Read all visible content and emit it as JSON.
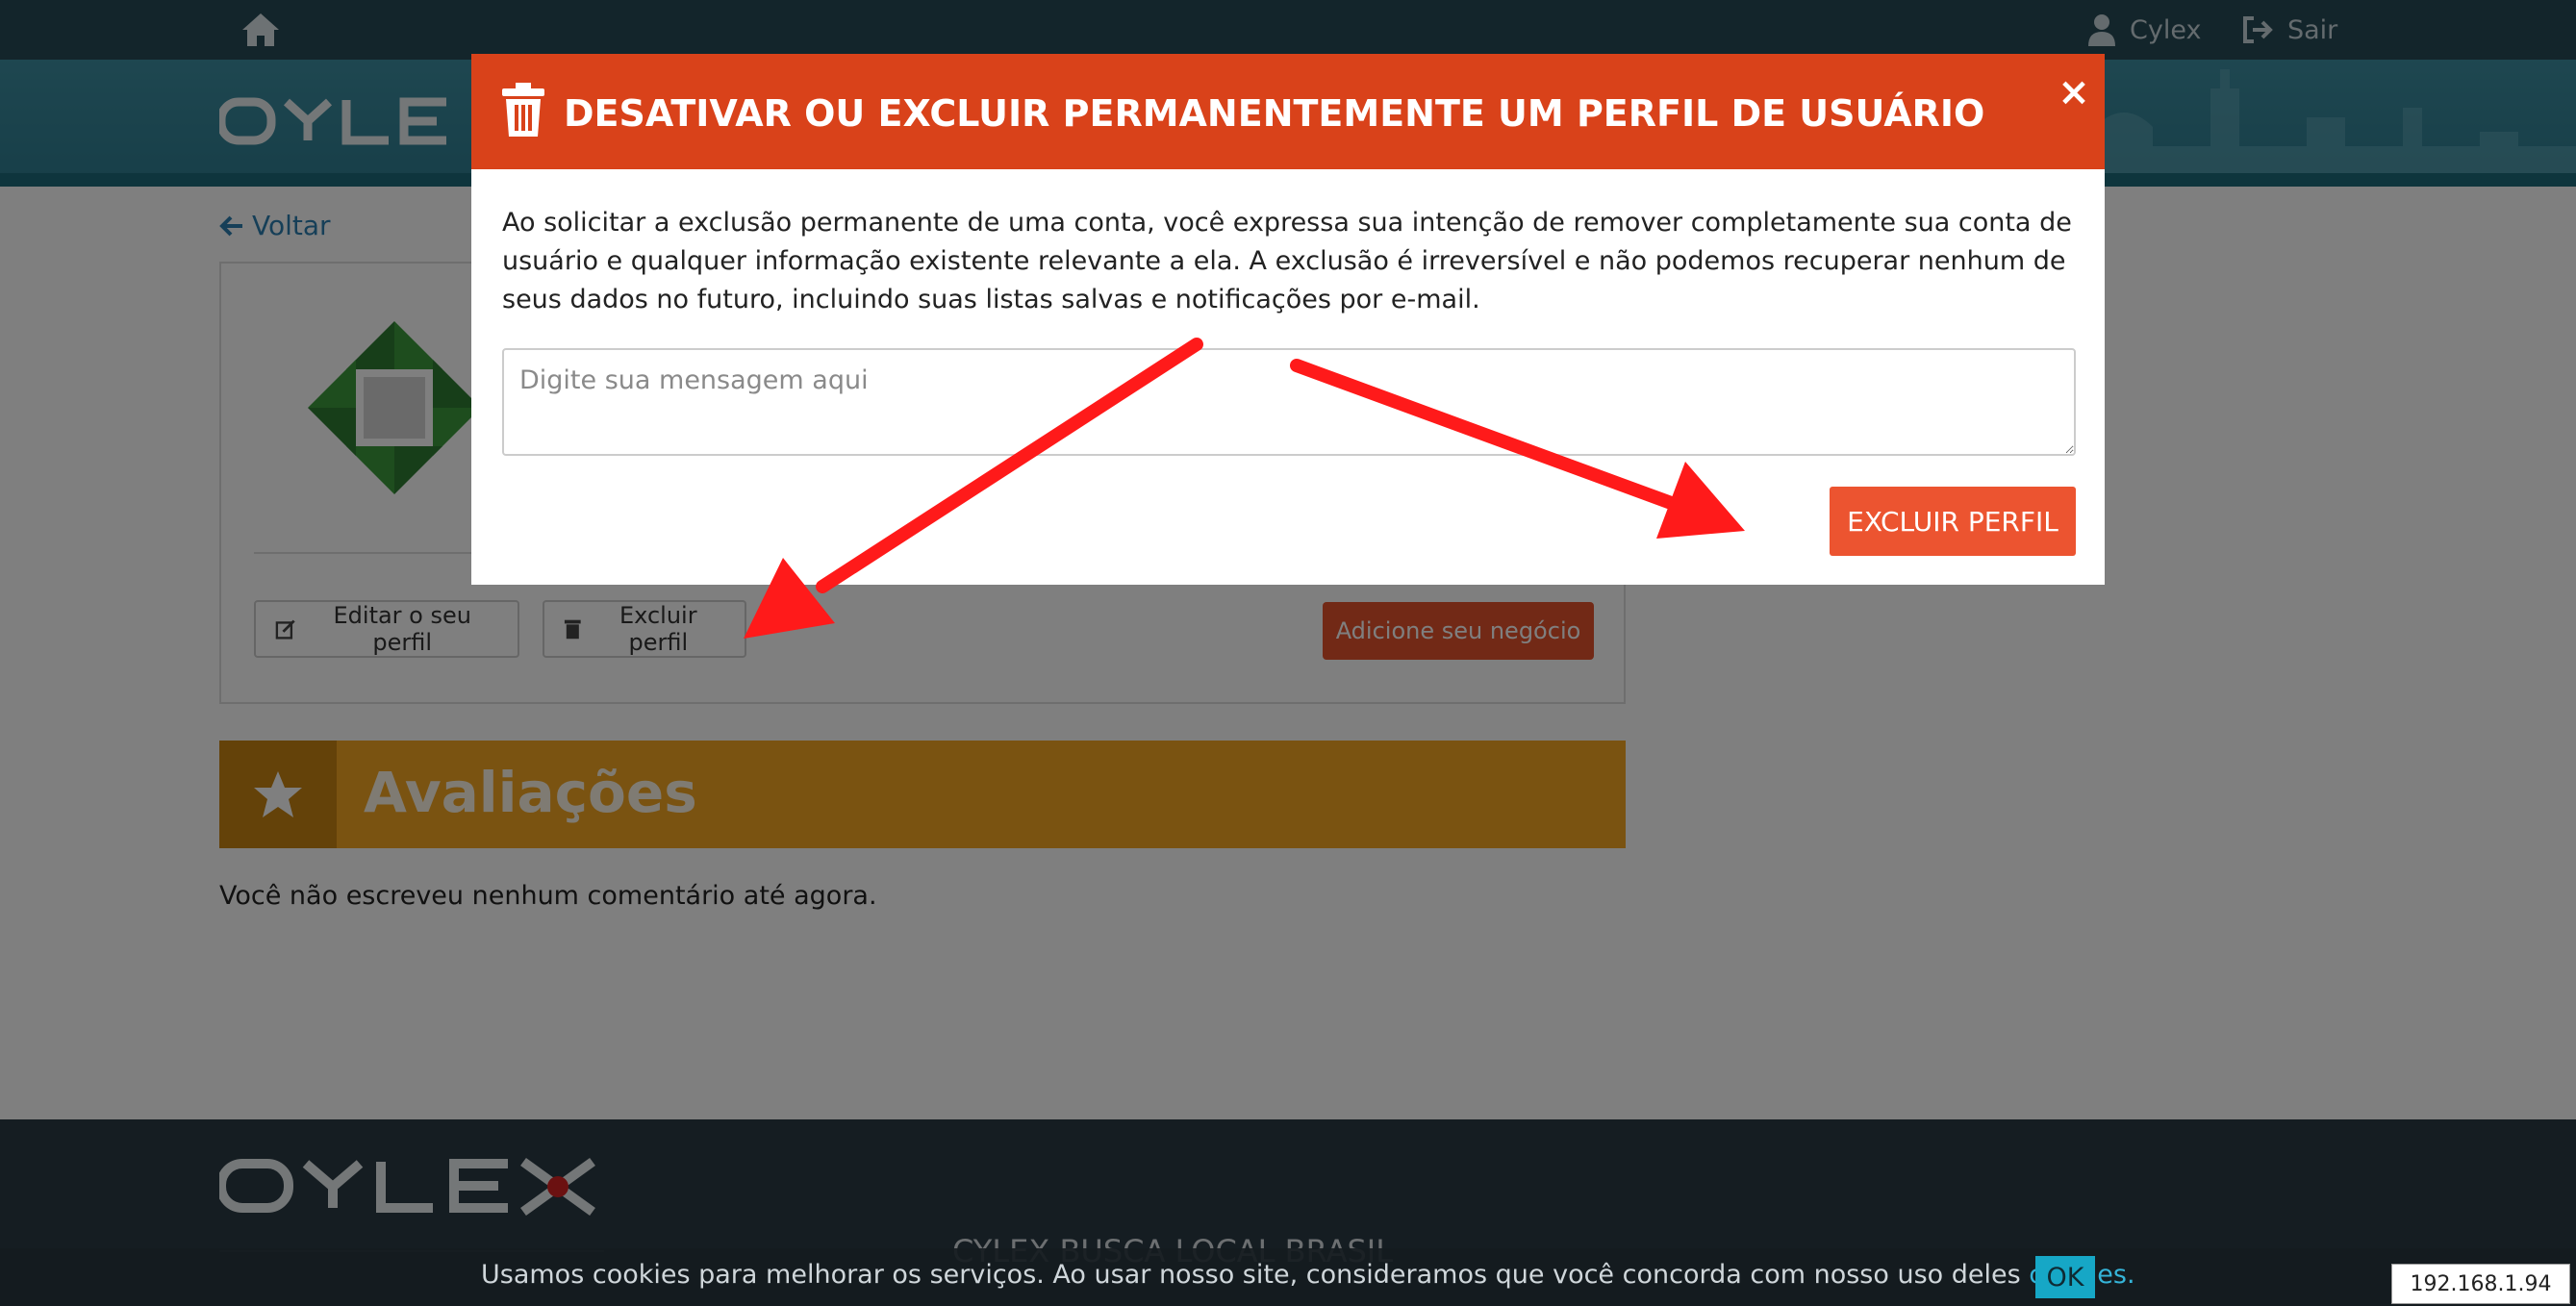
{
  "topbar": {
    "user_label": "Cylex",
    "logout_label": "Sair"
  },
  "page": {
    "back_label": "Voltar",
    "edit_profile_label": "Editar o seu perfil",
    "delete_profile_label": "Excluir perfil",
    "add_business_label": "Adicione seu negócio",
    "reviews_title": "Avaliações",
    "no_reviews_text": "Você não escreveu nenhum comentário até agora."
  },
  "footer": {
    "title": "CYLEX BUSCA LOCAL BRASIL"
  },
  "cookie": {
    "text": "Usamos cookies para melhorar os serviços. Ao usar nosso site, consideramos que você concorda com nosso uso deles",
    "link": "cookies.",
    "ok_label": "OK"
  },
  "ip_badge": "192.168.1.94",
  "modal": {
    "title": "DESATIVAR OU EXCLUIR PERMANENTEMENTE UM PERFIL DE USUÁRIO",
    "close_label": "×",
    "body": "Ao solicitar a exclusão permanente de uma conta, você expressa sua intenção de remover completamente sua conta de usuário e qualquer informação existente relevante a ela. A exclusão é irreversível e não podemos recuperar nenhum de seus dados no futuro, incluindo suas listas salvas e notificações por e-mail.",
    "textarea_placeholder": "Digite sua mensagem aqui",
    "textarea_value": "",
    "confirm_label": "EXCLUIR PERFIL"
  },
  "icons": [
    "home-icon",
    "user-icon",
    "logout-icon",
    "arrow-left-icon",
    "edit-icon",
    "trash-icon",
    "star-icon",
    "close-icon"
  ],
  "colors": {
    "topbar": "#274a56",
    "modal_header": "#d9421a",
    "confirm_button": "#ec5430",
    "reviews_bar": "#f5a623",
    "footer": "#2b3b45",
    "annotation_arrow": "#ff1a1a"
  }
}
